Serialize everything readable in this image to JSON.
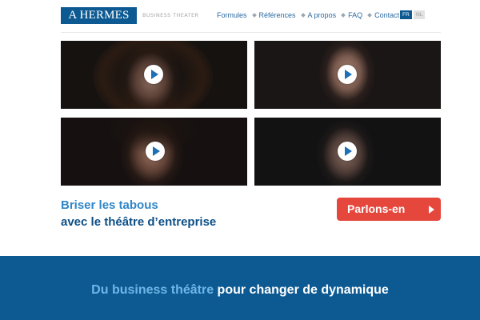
{
  "header": {
    "logo": "A HERMES",
    "tagline": "BUSINESS THEATER",
    "nav": [
      {
        "label": "Formules"
      },
      {
        "label": "Références"
      },
      {
        "label": "A propos"
      },
      {
        "label": "FAQ"
      },
      {
        "label": "Contact"
      }
    ],
    "languages": {
      "fr": "FR",
      "nl": "NL",
      "active": "FR"
    }
  },
  "videos": [
    {
      "icon": "play-icon"
    },
    {
      "icon": "play-icon"
    },
    {
      "icon": "play-icon"
    },
    {
      "icon": "play-icon"
    }
  ],
  "hero": {
    "line1": "Briser les tabous",
    "line2": "avec le théâtre d’entreprise",
    "cta_label": "Parlons-en",
    "cta_icon": "arrow-right-icon"
  },
  "band": {
    "text_part1": "Du business théâtre",
    "text_part2": " pour changer de dynamique"
  },
  "colors": {
    "brand_blue": "#0d5a93",
    "link_blue": "#2c6aa1",
    "accent_red": "#e5473d",
    "light_blue": "#2f86c8"
  }
}
